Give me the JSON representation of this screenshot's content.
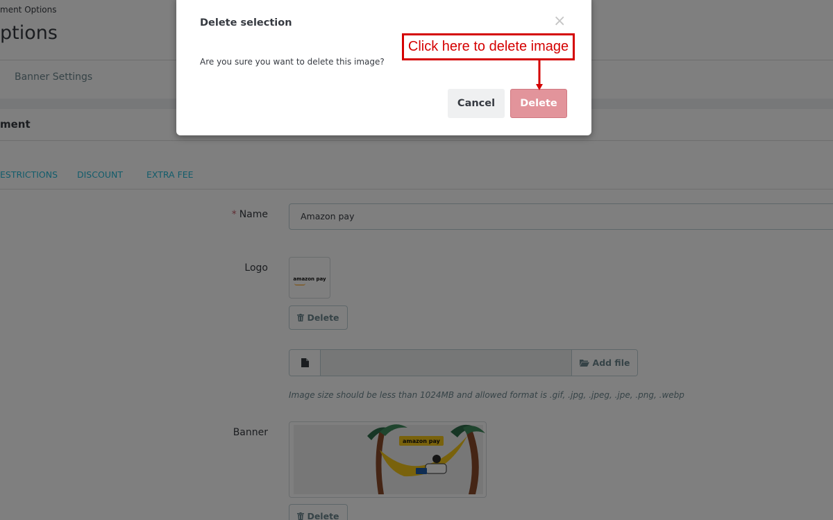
{
  "page": {
    "breadcrumb": "ment Options",
    "title": "ptions",
    "top_tab": "Banner Settings",
    "section_title": "ment",
    "sub_tabs": [
      "ESTRICTIONS",
      "DISCOUNT",
      "EXTRA FEE"
    ]
  },
  "form": {
    "name_label": "Name",
    "name_required_mark": "*",
    "name_value": "Amazon pay",
    "logo_label": "Logo",
    "logo_image_text": "amazon pay",
    "delete_label": "Delete",
    "add_file_label": "Add file",
    "help_text": "Image size should be less than 1024MB and allowed format is .gif, .jpg, .jpeg, .jpe, .png, .webp",
    "banner_label": "Banner",
    "banner_image_text": "amazon pay"
  },
  "modal": {
    "title": "Delete selection",
    "close_symbol": "×",
    "message": "Are you sure you want to delete this image?",
    "cancel_label": "Cancel",
    "delete_label": "Delete"
  },
  "annotation": {
    "text": "Click here to delete image"
  },
  "colors": {
    "callout_red": "#d40000",
    "delete_button": "#e2949b",
    "link_blue": "#25b9d7",
    "overlay": "rgba(0,0,0,0.5)"
  },
  "icons": [
    "trash-icon",
    "file-icon",
    "folder-open-icon",
    "close-icon"
  ]
}
